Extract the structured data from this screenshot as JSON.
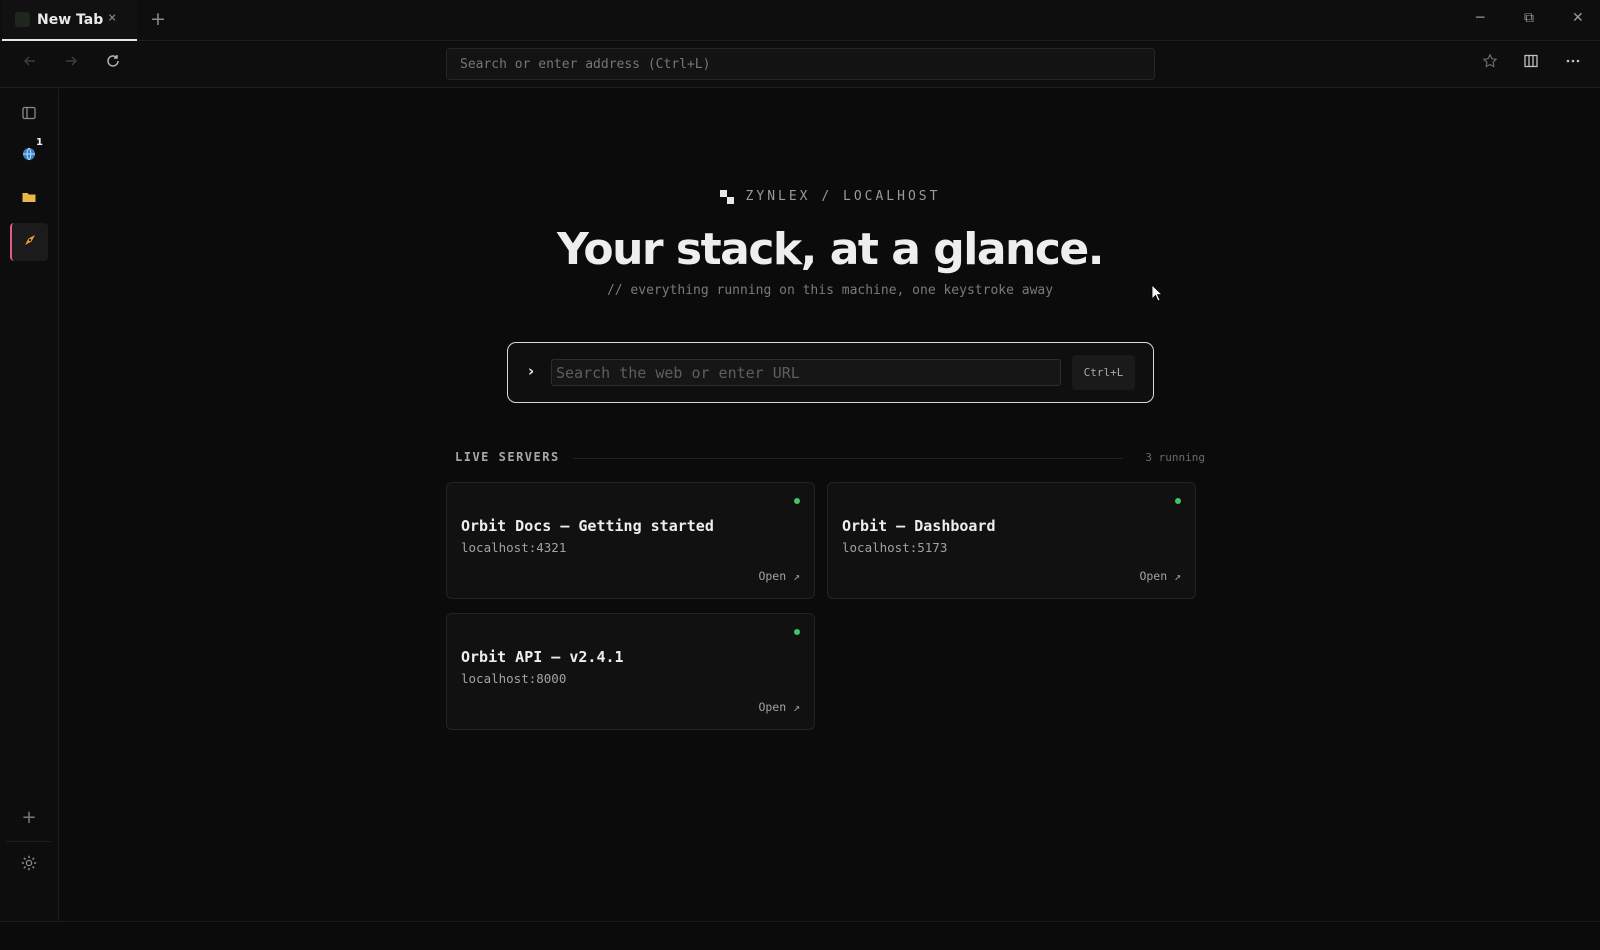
{
  "tab": {
    "title": "New Tab",
    "close_glyph": "×"
  },
  "toolbar": {
    "new_tab_glyph": "+",
    "address_placeholder": "Search or enter address (Ctrl+L)"
  },
  "window_controls": {
    "minimize": "─",
    "restore": "⧉",
    "close": "✕"
  },
  "sidebar": {
    "badge": "1",
    "add_glyph": "+"
  },
  "hero": {
    "brand": "ZYNLEX / LOCALHOST",
    "title": "Your stack, at a glance.",
    "subtitle": "// everything running on this machine, one keystroke away"
  },
  "search": {
    "placeholder": "Search the web or enter URL",
    "shortcut": "Ctrl+L",
    "prompt_glyph": "›"
  },
  "servers": {
    "label": "LIVE SERVERS",
    "count": "3 running",
    "items": [
      {
        "title": "Orbit Docs — Getting started",
        "url": "localhost:4321",
        "open": "Open ↗"
      },
      {
        "title": "Orbit — Dashboard",
        "url": "localhost:5173",
        "open": "Open ↗"
      },
      {
        "title": "Orbit API — v2.4.1",
        "url": "localhost:8000",
        "open": "Open ↗"
      }
    ]
  },
  "colors": {
    "background": "#0b0b0b",
    "accent_active": "#e05b8a",
    "status_online": "#3ec46d",
    "folder_icon": "#e8b84a",
    "globe_icon": "#4a9de0",
    "compass_icon": "#f0a030"
  },
  "icons": {
    "sidebar": [
      "sidebar-toggle-icon",
      "globe-icon",
      "folder-icon",
      "compass-icon",
      "plus-icon",
      "gear-icon"
    ],
    "toolbar": [
      "back-icon",
      "forward-icon",
      "reload-icon",
      "star-icon",
      "split-view-icon",
      "more-icon"
    ]
  }
}
